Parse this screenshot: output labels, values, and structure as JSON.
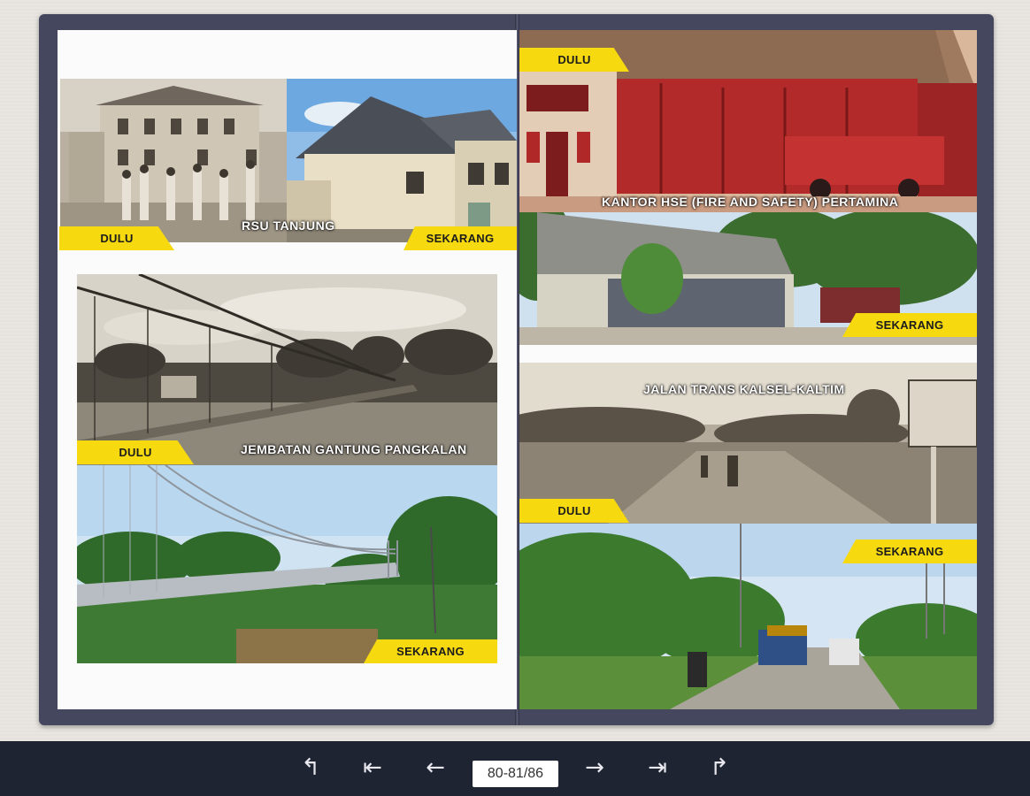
{
  "book": {
    "left_page": {
      "photos": [
        {
          "name": "rsu-tanjung-then",
          "tag": "DULU"
        },
        {
          "name": "rsu-tanjung-now",
          "tag": "SEKARANG"
        },
        {
          "name": "jembatan-then",
          "tag": "DULU"
        },
        {
          "name": "jembatan-now",
          "tag": "SEKARANG"
        }
      ],
      "rsu_caption": "RSU TANJUNG",
      "jembatan_caption": "JEMBATAN GANTUNG PANGKALAN",
      "tag_dulu": "DULU",
      "tag_sekarang": "SEKARANG"
    },
    "right_page": {
      "hse_caption": "KANTOR HSE (FIRE AND SAFETY) PERTAMINA",
      "jalan_caption": "JALAN TRANS KALSEL-KALTIM",
      "tag_dulu": "DULU",
      "tag_sekarang": "SEKARANG"
    }
  },
  "toolbar": {
    "page_value": "80-81/86",
    "buttons": {
      "undo": "↰",
      "first": "⇤",
      "prev": "←",
      "next": "→",
      "last": "⇥",
      "redo": "↱"
    }
  },
  "colors": {
    "tag_yellow": "#f6d90f",
    "frame": "#45475f",
    "toolbar_bg": "#1f2433"
  }
}
